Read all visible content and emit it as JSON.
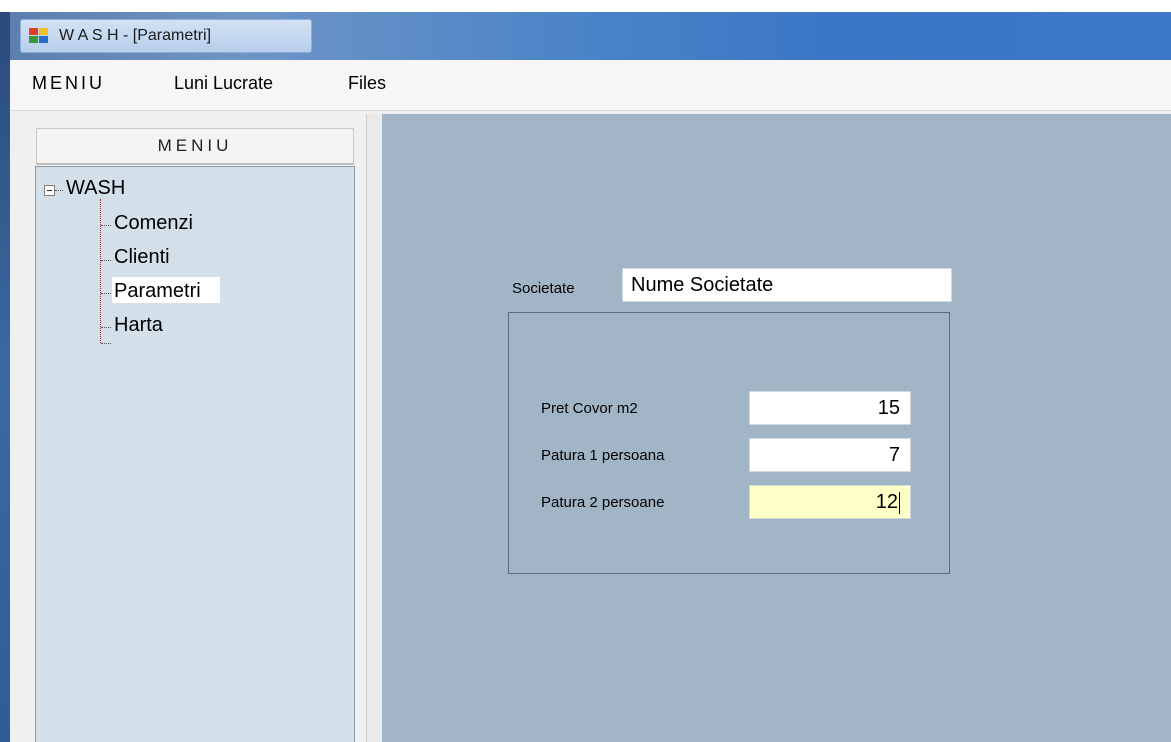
{
  "window": {
    "title": "W A S H - [Parametri]"
  },
  "menubar": {
    "items": [
      {
        "label": "MENIU"
      },
      {
        "label": "Luni Lucrate"
      },
      {
        "label": "Files"
      }
    ]
  },
  "left_panel": {
    "header": "MENIU",
    "tree": {
      "root": "WASH",
      "children": [
        {
          "label": "Comenzi"
        },
        {
          "label": "Clienti"
        },
        {
          "label": "Parametri",
          "selected": true
        },
        {
          "label": "Harta"
        }
      ]
    }
  },
  "form": {
    "societate_label": "Societate",
    "societate_value": "Nume Societate",
    "params": [
      {
        "label": "Pret Covor m2",
        "value": "15"
      },
      {
        "label": "Patura 1 persoana",
        "value": "7"
      },
      {
        "label": "Patura 2 persoane",
        "value": "12"
      }
    ]
  },
  "colors": {
    "main_background": "#a2b5c7",
    "tree_background": "#d3e0ea",
    "focused_input": "#ffffc8"
  }
}
